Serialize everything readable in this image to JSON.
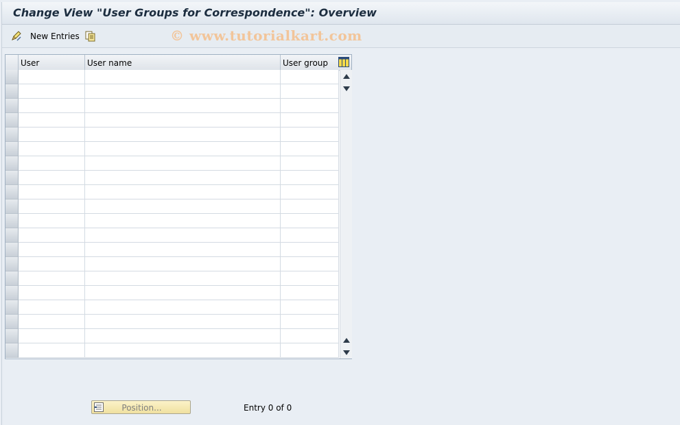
{
  "window": {
    "title": "Change View \"User Groups for Correspondence\": Overview"
  },
  "toolbar": {
    "new_entries_label": "New Entries",
    "watermark": "© www.tutorialkart.com",
    "icons": [
      "edit-pencil-icon",
      "copy-icon"
    ]
  },
  "table": {
    "columns": [
      "User",
      "User name",
      "User group"
    ],
    "visible_rows": 20,
    "rows": []
  },
  "footer": {
    "position_button_label": "Position...",
    "entry_text": "Entry 0 of 0"
  },
  "colors": {
    "background": "#e9eef4",
    "title_text": "#1c2d3f",
    "position_button": "#f7ebb6",
    "watermark": "#f2c59a"
  }
}
